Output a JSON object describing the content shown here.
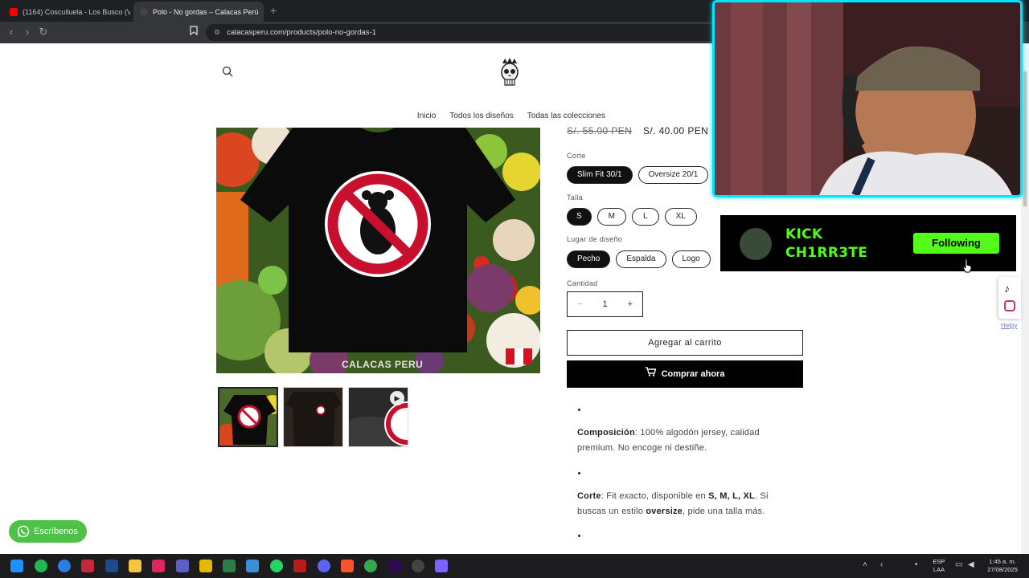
{
  "browser": {
    "tabs": [
      {
        "title": "(1164) Cosculluela - Los Busco (Visua",
        "active": false
      },
      {
        "title": "Polo - No gordas – Calacas Perú",
        "active": true
      }
    ],
    "new_tab": "+",
    "url": "calacasperu.com/products/polo-no-gordas-1"
  },
  "site": {
    "nav": [
      "Inicio",
      "Todos los diseños",
      "Todas las colecciones"
    ],
    "image_watermark": "CALACAS PERU"
  },
  "product": {
    "price_old": "S/. 55.00 PEN",
    "price_new": "S/. 40.00 PEN",
    "corte_label": "Corte",
    "corte_options": [
      "Slim Fit 30/1",
      "Oversize 20/1"
    ],
    "talla_label": "Talla",
    "talla_options": [
      "S",
      "M",
      "L",
      "XL"
    ],
    "lugar_label": "Lugar de diseño",
    "lugar_options": [
      "Pecho",
      "Espalda",
      "Logo"
    ],
    "cantidad_label": "Cantidad",
    "qty_minus": "−",
    "qty_value": "1",
    "qty_plus": "+",
    "add_to_cart": "Agregar al carrito",
    "buy_now": "Comprar ahora",
    "desc1_strong": "Composición",
    "desc1_text": ": 100% algodón jersey, calidad premium. No encoge ni destiñe.",
    "desc2_strong": "Corte",
    "desc2_text_a": ": Fit exacto, disponible en ",
    "desc2_sizes": "S, M, L, XL",
    "desc2_text_b": ". Si buscas un estilo ",
    "desc2_over": "oversize",
    "desc2_text_c": ", pide una talla más."
  },
  "whatsapp": {
    "label": "Escríbenos"
  },
  "kick": {
    "line1": "KICK",
    "line2": "CH1RR3TE",
    "follow_label": "Following",
    "brand_color": "#53fc18"
  },
  "social": {
    "helpy": "Helpy"
  },
  "taskbar": {
    "lang1": "ESP",
    "lang2": "LAA",
    "time": "1:45 a. m.",
    "date": "27/08/2025"
  }
}
